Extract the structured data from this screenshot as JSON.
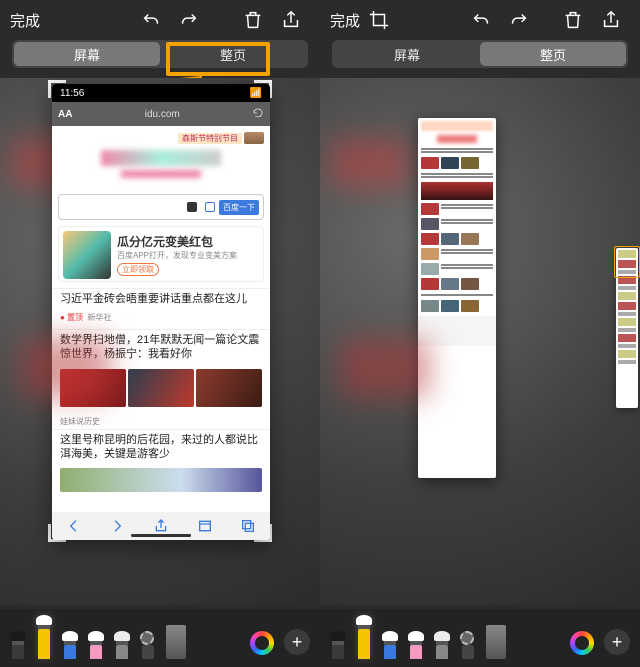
{
  "common": {
    "done": "完成",
    "seg_screen": "屏幕",
    "seg_full": "整页"
  },
  "phone": {
    "time": "11:56",
    "aa": "AA",
    "url": "idu.com",
    "banner_text": "森斯节特别节目",
    "promo_title": "瓜分亿元变美红包",
    "promo_sub": "百度APP打开，发现专业变美方案",
    "promo_btn": "立即领取",
    "search_btn": "百度一下",
    "news1_title": "习近平金砖会晤重要讲话重点都在这儿",
    "news1_tag": "● 置顶",
    "news1_src": "新华社",
    "news2_title": "数学界扫地僧，21年默默无闻一篇论文震惊世界，杨振宁：我看好你",
    "news2_src": "娃妹说历史",
    "news3_title": "这里号称昆明的后花园，来过的人都说比洱海美，关键是游客少",
    "pano_src": ""
  },
  "tools": {
    "color": "color-picker",
    "plus": "+"
  }
}
